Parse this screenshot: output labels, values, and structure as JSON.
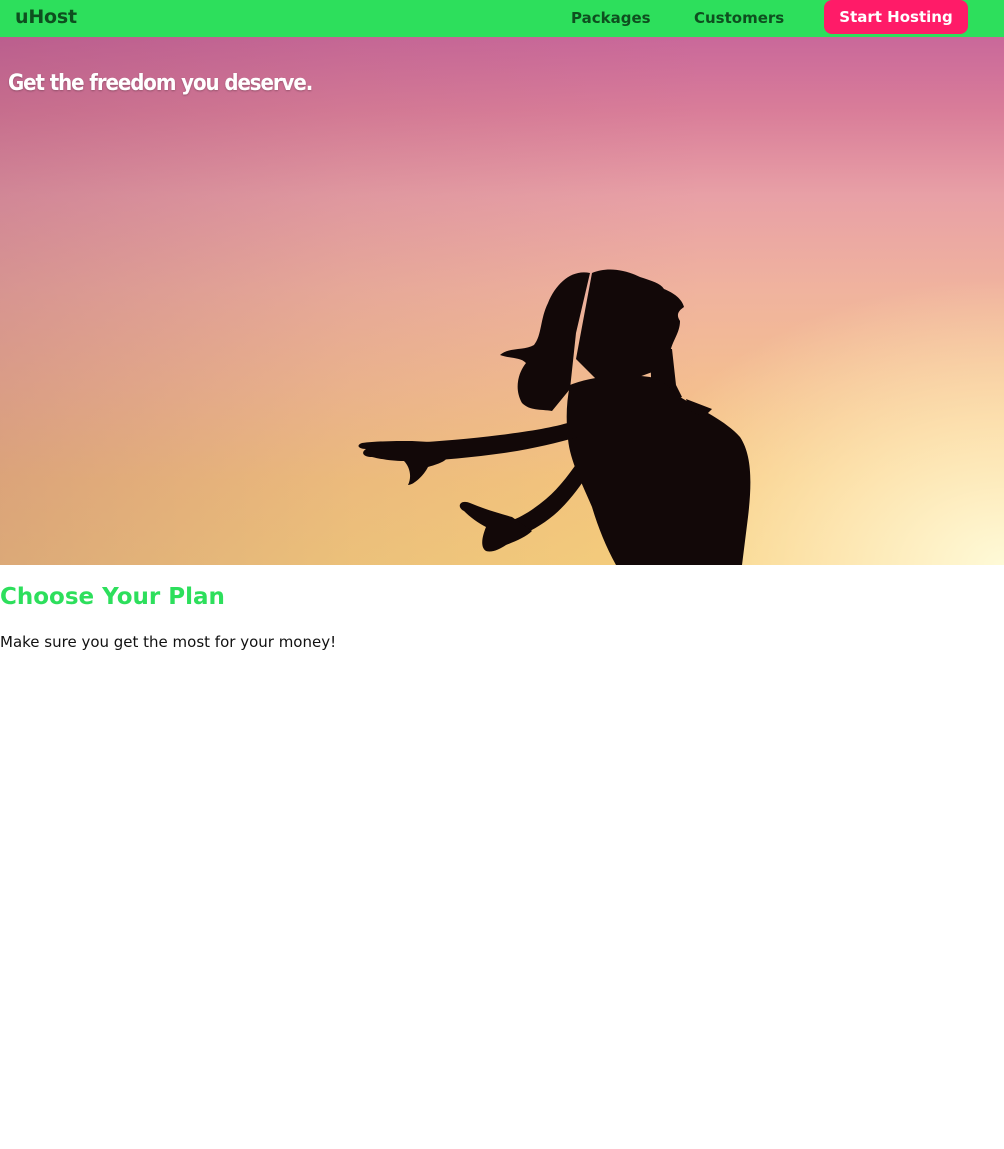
{
  "header": {
    "brand": "uHost",
    "nav_items": [
      {
        "label": "Packages"
      },
      {
        "label": "Customers"
      }
    ],
    "cta_label": "Start Hosting"
  },
  "hero": {
    "title": "Get the freedom you deserve."
  },
  "plans": {
    "title": "Choose Your Plan",
    "subtitle": "Make sure you get the most for your money!"
  },
  "colors": {
    "nav_background": "#2ddf5c",
    "nav_text": "#0e4f1f",
    "cta_background": "#ff1b68",
    "accent_heading": "#2ddf5c"
  }
}
